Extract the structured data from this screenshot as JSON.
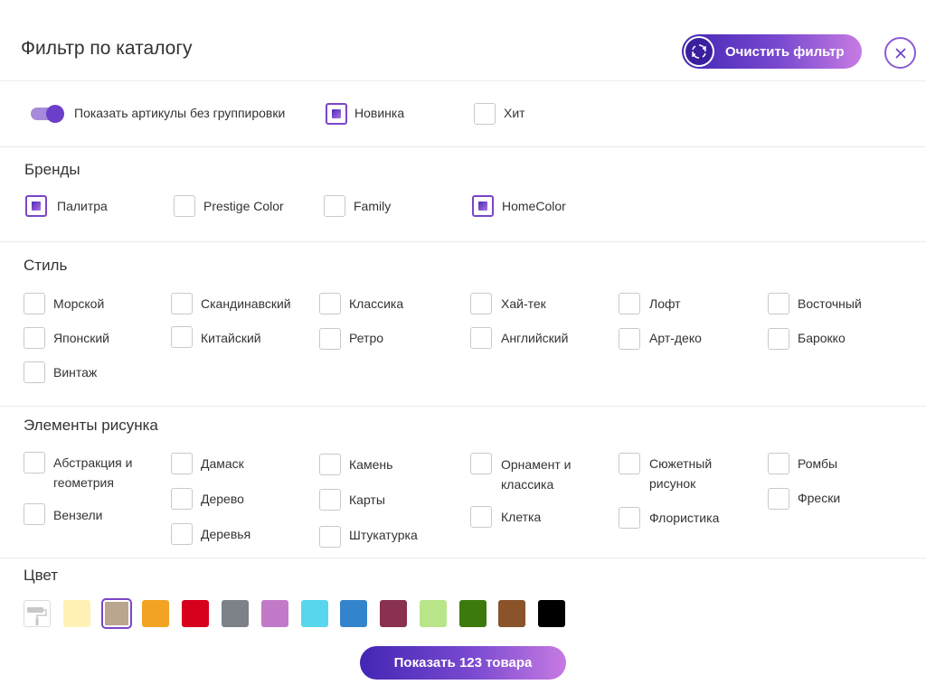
{
  "header": {
    "title": "Фильтр по каталогу",
    "clear_label": "Очистить фильтр",
    "clear_icon": "refresh-icon",
    "close_icon": "close-icon"
  },
  "options": {
    "toggle_label": "Показать артикулы без группировки",
    "toggle_on": true,
    "new_label": "Новинка",
    "new_checked": true,
    "hit_label": "Хит",
    "hit_checked": false
  },
  "brands": {
    "title": "Бренды",
    "items": [
      {
        "label": "Палитра",
        "checked": true
      },
      {
        "label": "Prestige Color",
        "checked": false
      },
      {
        "label": "Family",
        "checked": false
      },
      {
        "label": "HomeColor",
        "checked": true
      }
    ]
  },
  "style": {
    "title": "Стиль",
    "items": [
      {
        "label": "Морской"
      },
      {
        "label": "Скандинавский"
      },
      {
        "label": "Классика"
      },
      {
        "label": "Хай-тек"
      },
      {
        "label": "Лофт"
      },
      {
        "label": "Восточный"
      },
      {
        "label": "Японский"
      },
      {
        "label": "Китайский"
      },
      {
        "label": "Ретро"
      },
      {
        "label": "Английский"
      },
      {
        "label": "Арт-деко"
      },
      {
        "label": "Барокко"
      },
      {
        "label": "Винтаж"
      }
    ]
  },
  "elements": {
    "title": "Элементы рисунка",
    "items": [
      {
        "label": "Абстракция и",
        "label2": "геометрия"
      },
      {
        "label": "Вензели"
      },
      {
        "label": "Дамаск"
      },
      {
        "label": "Дерево"
      },
      {
        "label": "Деревья"
      },
      {
        "label": "Камень"
      },
      {
        "label": "Карты"
      },
      {
        "label": "Штукатурка"
      },
      {
        "label": "Орнамент и",
        "label2": "классика"
      },
      {
        "label": "Клетка"
      },
      {
        "label": "Сюжетный",
        "label2": "рисунок"
      },
      {
        "label": "Флористика"
      },
      {
        "label": "Ромбы"
      },
      {
        "label": "Фрески"
      }
    ]
  },
  "color": {
    "title": "Цвет",
    "any_icon": "paint-roller-icon",
    "swatches": [
      {
        "hex": "#fff1b3",
        "selected": false
      },
      {
        "hex": "#baa58e",
        "selected": true
      },
      {
        "hex": "#f2a324",
        "selected": false
      },
      {
        "hex": "#d6001c",
        "selected": false
      },
      {
        "hex": "#7c8288",
        "selected": false
      },
      {
        "hex": "#c27ac8",
        "selected": false
      },
      {
        "hex": "#58d6ed",
        "selected": false
      },
      {
        "hex": "#3484cc",
        "selected": false
      },
      {
        "hex": "#8a3050",
        "selected": false
      },
      {
        "hex": "#b9e689",
        "selected": false
      },
      {
        "hex": "#3d7a0d",
        "selected": false
      },
      {
        "hex": "#8a532a",
        "selected": false
      },
      {
        "hex": "#000000",
        "selected": false
      }
    ]
  },
  "footer": {
    "show_label": "Показать 123 товара"
  }
}
